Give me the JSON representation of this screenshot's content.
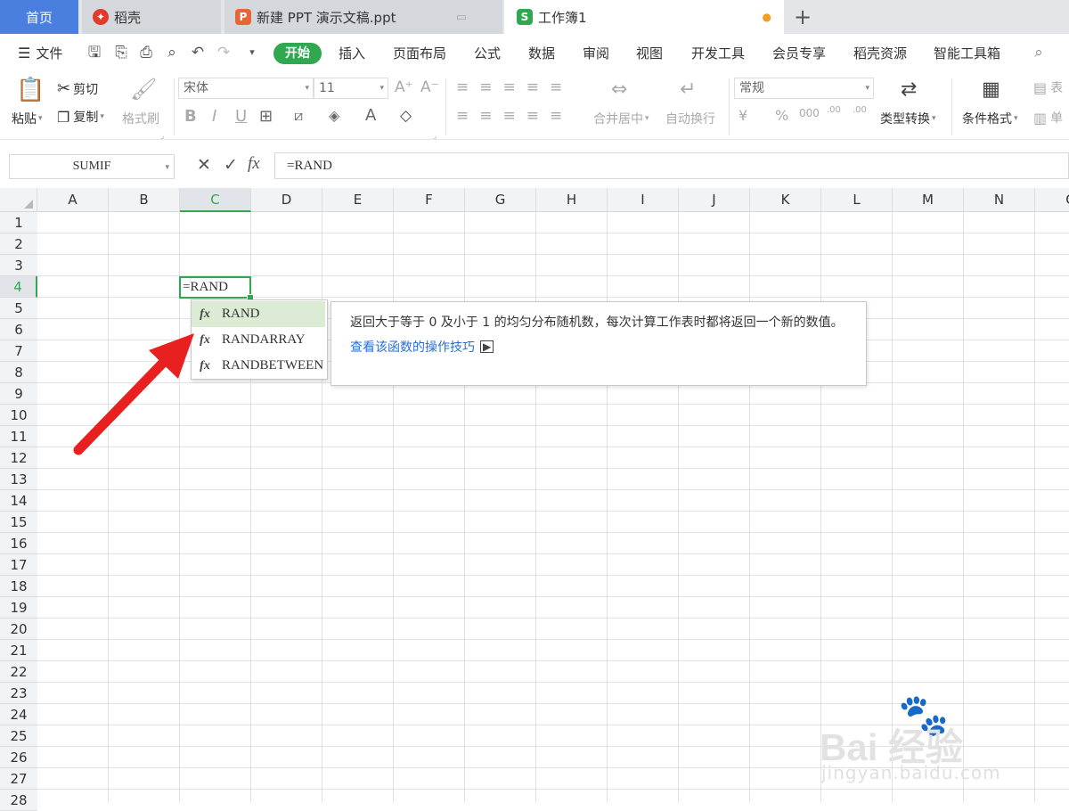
{
  "tabs": [
    {
      "label": "首页",
      "icon": "home"
    },
    {
      "label": "稻壳",
      "icon": "docer-icon"
    },
    {
      "label": "新建 PPT 演示文稿.ppt",
      "icon": "ppt-icon"
    },
    {
      "label": "工作簿1",
      "icon": "sheet-icon"
    }
  ],
  "menu": {
    "file": "文件",
    "items": [
      "开始",
      "插入",
      "页面布局",
      "公式",
      "数据",
      "审阅",
      "视图",
      "开发工具",
      "会员专享",
      "稻壳资源",
      "智能工具箱"
    ]
  },
  "ribbon": {
    "paste": "粘贴",
    "cut": "剪切",
    "copy": "复制",
    "format_painter": "格式刷",
    "font_name": "宋体",
    "font_size": "11",
    "merge_center": "合并居中",
    "wrap_text": "自动换行",
    "number_format": "常规",
    "type_convert": "类型转换",
    "cond_format": "条件格式",
    "table_style": "表",
    "cell": "单"
  },
  "formula_bar": {
    "name_box": "SUMIF",
    "fx_label": "fx",
    "value": "=RAND"
  },
  "columns": [
    "A",
    "B",
    "C",
    "D",
    "E",
    "F",
    "G",
    "H",
    "I",
    "J",
    "K",
    "L",
    "M",
    "N",
    "C"
  ],
  "rows": [
    "1",
    "2",
    "3",
    "4",
    "5",
    "6",
    "7",
    "8",
    "9",
    "10",
    "11",
    "12",
    "13",
    "14",
    "15",
    "16",
    "17",
    "18",
    "19",
    "20",
    "21",
    "22",
    "23",
    "24",
    "25",
    "26",
    "27",
    "28"
  ],
  "active_cell": {
    "column": "C",
    "row": "4",
    "value": "=RAND"
  },
  "autocomplete": {
    "items": [
      "RAND",
      "RANDARRAY",
      "RANDBETWEEN"
    ],
    "fx": "fx",
    "description": "返回大于等于 0 及小于 1 的均匀分布随机数，每次计算工作表时都将返回一个新的数值。",
    "link": "查看该函数的操作技巧"
  },
  "watermark": {
    "brand": "Bai 经验",
    "url": "jingyan.baidu.com"
  },
  "colors": {
    "accent": "#2fa84f",
    "home_tab": "#4a7fe0",
    "arrow": "#e8201f",
    "link": "#2a6fd6"
  }
}
